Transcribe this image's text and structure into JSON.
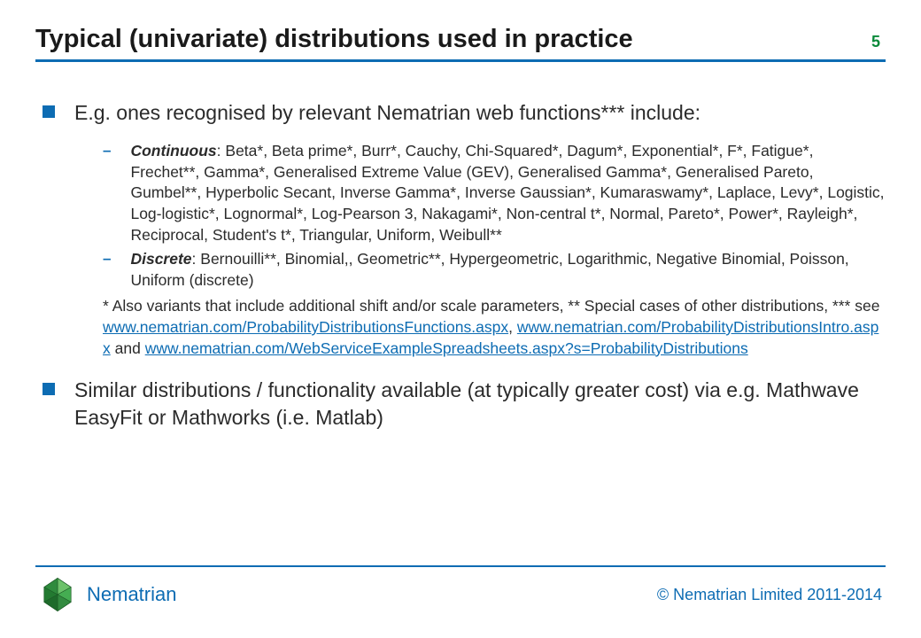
{
  "header": {
    "title": "Typical (univariate) distributions used in practice",
    "page_number": "5"
  },
  "bullets": {
    "b1": "E.g. ones recognised by relevant Nematrian web functions*** include:",
    "sub1_label": "Continuous",
    "sub1_text": ": Beta*, Beta prime*, Burr*, Cauchy, Chi-Squared*, Dagum*, Exponential*, F*, Fatigue*, Frechet**, Gamma*, Generalised Extreme Value (GEV), Generalised Gamma*, Generalised Pareto, Gumbel**, Hyperbolic Secant, Inverse Gamma*, Inverse Gaussian*, Kumaraswamy*, Laplace, Levy*, Logistic, Log-logistic*, Lognormal*, Log-Pearson 3, Nakagami*, Non-central t*, Normal, Pareto*, Power*, Rayleigh*, Reciprocal, Student's t*, Triangular, Uniform, Weibull**",
    "sub2_label": "Discrete",
    "sub2_text": ": Bernouilli**, Binomial,, Geometric**, Hypergeometric, Logarithmic, Negative Binomial, Poisson, Uniform (discrete)",
    "footnote_pre": "* Also variants that include additional shift and/or scale parameters, ** Special cases of other distributions, *** see ",
    "link1": "www.nematrian.com/ProbabilityDistributionsFunctions.aspx",
    "footnote_sep1": ", ",
    "link2": "www.nematrian.com/ProbabilityDistributionsIntro.aspx",
    "footnote_sep2": " and ",
    "link3": "www.nematrian.com/WebServiceExampleSpreadsheets.aspx?s=ProbabilityDistributions",
    "b2": "Similar distributions / functionality available (at typically greater cost) via e.g. Mathwave EasyFit or Mathworks (i.e. Matlab)"
  },
  "footer": {
    "brand": "Nematrian",
    "copyright": "© Nematrian Limited 2011-2014"
  }
}
